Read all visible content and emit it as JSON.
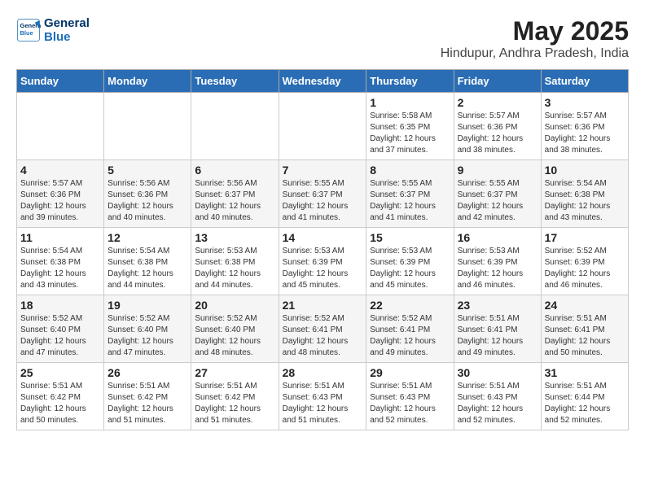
{
  "logo": {
    "line1": "General",
    "line2": "Blue"
  },
  "title": "May 2025",
  "subtitle": "Hindupur, Andhra Pradesh, India",
  "days_of_week": [
    "Sunday",
    "Monday",
    "Tuesday",
    "Wednesday",
    "Thursday",
    "Friday",
    "Saturday"
  ],
  "weeks": [
    [
      {
        "day": "",
        "info": ""
      },
      {
        "day": "",
        "info": ""
      },
      {
        "day": "",
        "info": ""
      },
      {
        "day": "",
        "info": ""
      },
      {
        "day": "1",
        "info": "Sunrise: 5:58 AM\nSunset: 6:35 PM\nDaylight: 12 hours\nand 37 minutes."
      },
      {
        "day": "2",
        "info": "Sunrise: 5:57 AM\nSunset: 6:36 PM\nDaylight: 12 hours\nand 38 minutes."
      },
      {
        "day": "3",
        "info": "Sunrise: 5:57 AM\nSunset: 6:36 PM\nDaylight: 12 hours\nand 38 minutes."
      }
    ],
    [
      {
        "day": "4",
        "info": "Sunrise: 5:57 AM\nSunset: 6:36 PM\nDaylight: 12 hours\nand 39 minutes."
      },
      {
        "day": "5",
        "info": "Sunrise: 5:56 AM\nSunset: 6:36 PM\nDaylight: 12 hours\nand 40 minutes."
      },
      {
        "day": "6",
        "info": "Sunrise: 5:56 AM\nSunset: 6:37 PM\nDaylight: 12 hours\nand 40 minutes."
      },
      {
        "day": "7",
        "info": "Sunrise: 5:55 AM\nSunset: 6:37 PM\nDaylight: 12 hours\nand 41 minutes."
      },
      {
        "day": "8",
        "info": "Sunrise: 5:55 AM\nSunset: 6:37 PM\nDaylight: 12 hours\nand 41 minutes."
      },
      {
        "day": "9",
        "info": "Sunrise: 5:55 AM\nSunset: 6:37 PM\nDaylight: 12 hours\nand 42 minutes."
      },
      {
        "day": "10",
        "info": "Sunrise: 5:54 AM\nSunset: 6:38 PM\nDaylight: 12 hours\nand 43 minutes."
      }
    ],
    [
      {
        "day": "11",
        "info": "Sunrise: 5:54 AM\nSunset: 6:38 PM\nDaylight: 12 hours\nand 43 minutes."
      },
      {
        "day": "12",
        "info": "Sunrise: 5:54 AM\nSunset: 6:38 PM\nDaylight: 12 hours\nand 44 minutes."
      },
      {
        "day": "13",
        "info": "Sunrise: 5:53 AM\nSunset: 6:38 PM\nDaylight: 12 hours\nand 44 minutes."
      },
      {
        "day": "14",
        "info": "Sunrise: 5:53 AM\nSunset: 6:39 PM\nDaylight: 12 hours\nand 45 minutes."
      },
      {
        "day": "15",
        "info": "Sunrise: 5:53 AM\nSunset: 6:39 PM\nDaylight: 12 hours\nand 45 minutes."
      },
      {
        "day": "16",
        "info": "Sunrise: 5:53 AM\nSunset: 6:39 PM\nDaylight: 12 hours\nand 46 minutes."
      },
      {
        "day": "17",
        "info": "Sunrise: 5:52 AM\nSunset: 6:39 PM\nDaylight: 12 hours\nand 46 minutes."
      }
    ],
    [
      {
        "day": "18",
        "info": "Sunrise: 5:52 AM\nSunset: 6:40 PM\nDaylight: 12 hours\nand 47 minutes."
      },
      {
        "day": "19",
        "info": "Sunrise: 5:52 AM\nSunset: 6:40 PM\nDaylight: 12 hours\nand 47 minutes."
      },
      {
        "day": "20",
        "info": "Sunrise: 5:52 AM\nSunset: 6:40 PM\nDaylight: 12 hours\nand 48 minutes."
      },
      {
        "day": "21",
        "info": "Sunrise: 5:52 AM\nSunset: 6:41 PM\nDaylight: 12 hours\nand 48 minutes."
      },
      {
        "day": "22",
        "info": "Sunrise: 5:52 AM\nSunset: 6:41 PM\nDaylight: 12 hours\nand 49 minutes."
      },
      {
        "day": "23",
        "info": "Sunrise: 5:51 AM\nSunset: 6:41 PM\nDaylight: 12 hours\nand 49 minutes."
      },
      {
        "day": "24",
        "info": "Sunrise: 5:51 AM\nSunset: 6:41 PM\nDaylight: 12 hours\nand 50 minutes."
      }
    ],
    [
      {
        "day": "25",
        "info": "Sunrise: 5:51 AM\nSunset: 6:42 PM\nDaylight: 12 hours\nand 50 minutes."
      },
      {
        "day": "26",
        "info": "Sunrise: 5:51 AM\nSunset: 6:42 PM\nDaylight: 12 hours\nand 51 minutes."
      },
      {
        "day": "27",
        "info": "Sunrise: 5:51 AM\nSunset: 6:42 PM\nDaylight: 12 hours\nand 51 minutes."
      },
      {
        "day": "28",
        "info": "Sunrise: 5:51 AM\nSunset: 6:43 PM\nDaylight: 12 hours\nand 51 minutes."
      },
      {
        "day": "29",
        "info": "Sunrise: 5:51 AM\nSunset: 6:43 PM\nDaylight: 12 hours\nand 52 minutes."
      },
      {
        "day": "30",
        "info": "Sunrise: 5:51 AM\nSunset: 6:43 PM\nDaylight: 12 hours\nand 52 minutes."
      },
      {
        "day": "31",
        "info": "Sunrise: 5:51 AM\nSunset: 6:44 PM\nDaylight: 12 hours\nand 52 minutes."
      }
    ]
  ]
}
